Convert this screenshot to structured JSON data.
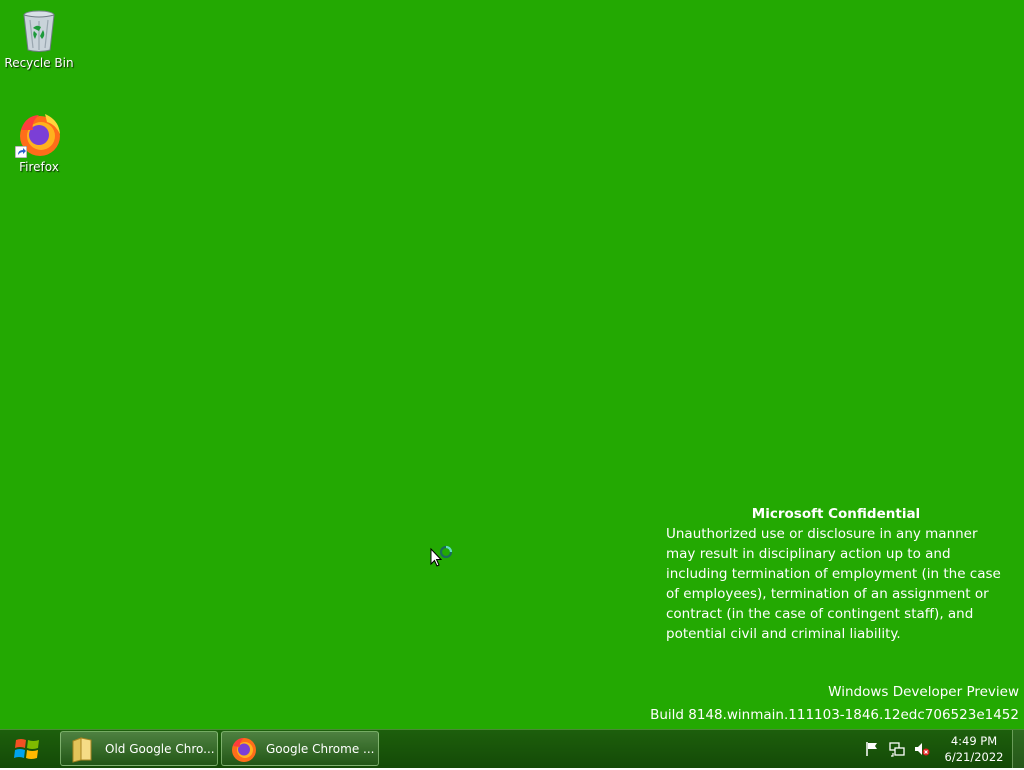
{
  "desktop": {
    "background_color": "#23a902",
    "icons": [
      {
        "label": "Recycle Bin",
        "icon": "recycle-bin-icon"
      },
      {
        "label": "Firefox",
        "icon": "firefox-icon"
      }
    ],
    "confidential": {
      "title": "Microsoft Confidential",
      "body": "Unauthorized use or disclosure in any manner may result in disciplinary action up to and including termination of employment (in the case of employees), termination of an assignment or contract (in the case of contingent staff), and potential civil and criminal liability."
    },
    "watermark": {
      "line1": "Windows Developer Preview",
      "line2": "Build 8148.winmain.111103-1846.12edc706523e1452"
    }
  },
  "taskbar": {
    "start_icon": "windows-logo-icon",
    "tasks": [
      {
        "label": "Old Google Chro...",
        "icon": "folder-icon"
      },
      {
        "label": "Google Chrome ...",
        "icon": "firefox-icon"
      }
    ],
    "tray_icons": [
      "flag-icon",
      "network-icon",
      "speaker-muted-icon"
    ],
    "clock": {
      "time": "4:49 PM",
      "date": "6/21/2022"
    }
  }
}
